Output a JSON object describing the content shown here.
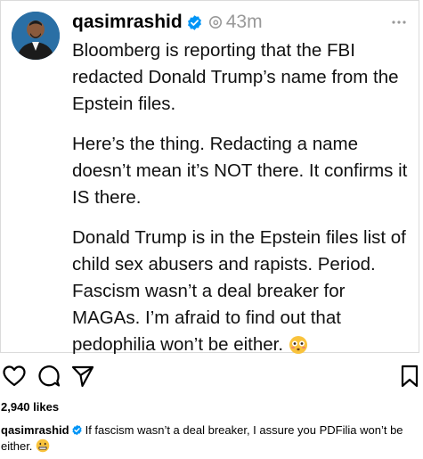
{
  "post_card": {
    "username": "qasimrashid",
    "timestamp": "43m",
    "paragraphs": [
      "Bloomberg is reporting that the FBI redacted Donald Trump’s name from the Epstein files.",
      "Here’s the thing. Redacting a name doesn’t mean it’s NOT there. It confirms it IS there.",
      "Donald Trump is in the Epstein files list of child sex abusers and rapists. Period. Fascism wasn’t a deal breaker for MAGAs. I’m afraid to find out that pedophilia won’t be either."
    ],
    "end_emoji": "flushed-face"
  },
  "feed": {
    "likes": "2,940 likes",
    "caption_user": "qasimrashid",
    "caption_text": "If fascism wasn’t a deal breaker, I assure you PDFilia won’t be either.",
    "caption_emoji": "grimacing-face"
  },
  "icons": {
    "like": "heart-icon",
    "comment": "comment-icon",
    "share": "send-icon",
    "save": "bookmark-icon",
    "more": "more-icon",
    "verified": "verified-badge-icon",
    "platform": "threads-logo-icon"
  },
  "colors": {
    "verified_blue": "#0095f6",
    "muted_gray": "#999999",
    "border": "#dbdbdb"
  }
}
